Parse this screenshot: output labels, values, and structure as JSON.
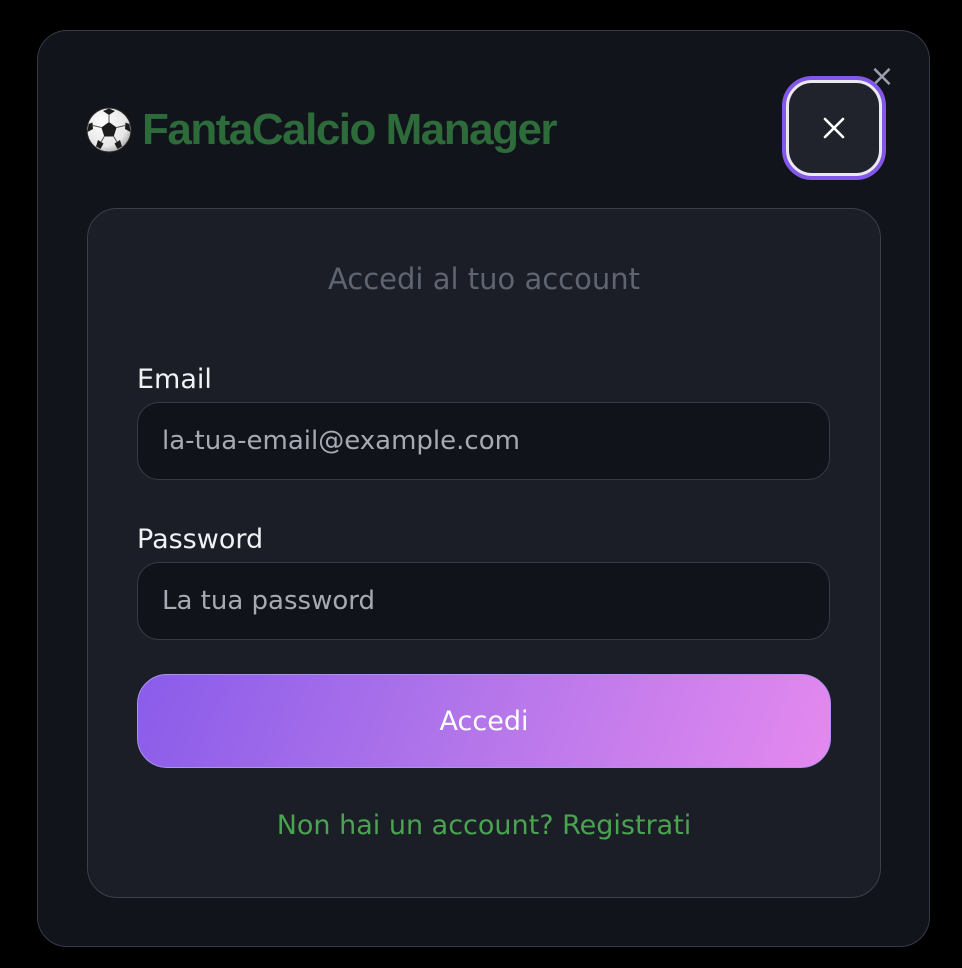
{
  "header": {
    "icon": "soccer-ball-icon",
    "title": "FantaCalcio Manager"
  },
  "modal": {
    "corner_close_glyph": "×",
    "close_icon": "close-icon"
  },
  "login": {
    "subtitle": "Accedi al tuo account",
    "email_label": "Email",
    "email_placeholder": "la-tua-email@example.com",
    "email_value": "",
    "password_label": "Password",
    "password_placeholder": "La tua password",
    "password_value": "",
    "submit_label": "Accedi",
    "register_link": "Non hai un account? Registrati"
  },
  "colors": {
    "background": "#000000",
    "modal_bg": "#11141b",
    "card_bg": "#1b1e26",
    "title_green": "#2e6b3a",
    "link_green": "#4aa350",
    "accent_purple": "#8358e8",
    "gradient_start": "#8a5cea",
    "gradient_end": "#e489ef"
  }
}
